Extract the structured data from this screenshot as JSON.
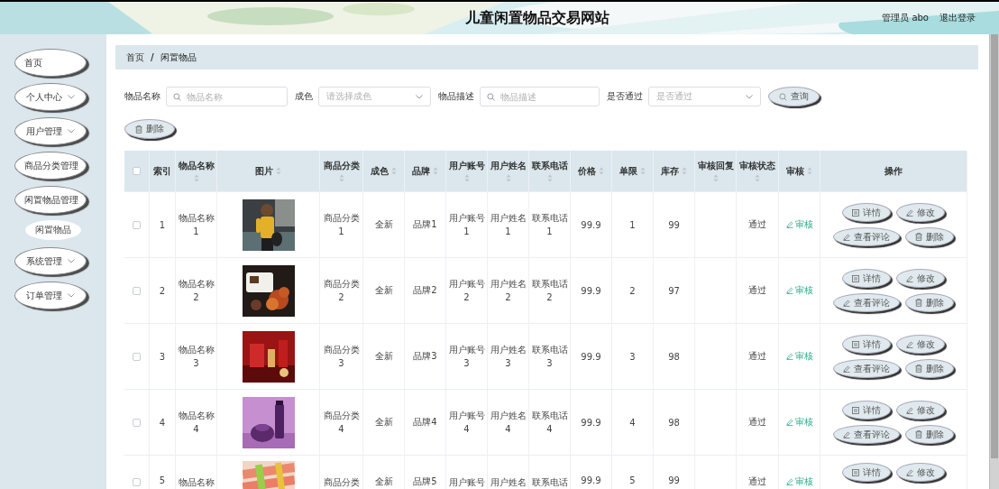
{
  "header": {
    "title": "儿童闲置物品交易网站",
    "user": "管理员 abo",
    "logout": "退出登录"
  },
  "sidebar": {
    "items": [
      {
        "label": "首页",
        "arrow": false
      },
      {
        "label": "个人中心",
        "arrow": true
      },
      {
        "label": "用户管理",
        "arrow": true
      },
      {
        "label": "商品分类管理",
        "arrow": false
      },
      {
        "label": "闲置物品管理",
        "arrow": false,
        "children": [
          {
            "label": "闲置物品"
          }
        ]
      },
      {
        "label": "系统管理",
        "arrow": true
      },
      {
        "label": "订单管理",
        "arrow": true
      }
    ]
  },
  "breadcrumb": {
    "items": [
      "首页",
      "闲置物品"
    ],
    "separator": "/"
  },
  "filters": [
    {
      "label": "物品名称",
      "kind": "input",
      "placeholder": "物品名称"
    },
    {
      "label": "成色",
      "kind": "select",
      "placeholder": "请选择成色"
    },
    {
      "label": "物品描述",
      "kind": "input",
      "placeholder": "物品描述"
    },
    {
      "label": "是否通过",
      "kind": "select",
      "placeholder": "是否通过"
    }
  ],
  "search_button": "查询",
  "delete_button": "删除",
  "table": {
    "select_all": {
      "checked": false
    },
    "columns": [
      {
        "label": "索引",
        "sortable": false
      },
      {
        "label": "物品名称",
        "sortable": true
      },
      {
        "label": "图片",
        "sortable": true
      },
      {
        "label": "商品分类",
        "sortable": true
      },
      {
        "label": "成色",
        "sortable": true
      },
      {
        "label": "品牌",
        "sortable": true
      },
      {
        "label": "用户账号",
        "sortable": true
      },
      {
        "label": "用户姓名",
        "sortable": true
      },
      {
        "label": "联系电话",
        "sortable": true
      },
      {
        "label": "价格",
        "sortable": true
      },
      {
        "label": "单限",
        "sortable": true
      },
      {
        "label": "库存",
        "sortable": true
      },
      {
        "label": "审核回复",
        "sortable": true
      },
      {
        "label": "审核状态",
        "sortable": true
      },
      {
        "label": "审核",
        "sortable": true
      },
      {
        "label": "操作",
        "sortable": false
      }
    ],
    "rows": [
      {
        "checked": false,
        "index": "1",
        "name": "物品名称1",
        "image": {
          "kind": "picture"
        },
        "category": "商品分类1",
        "condition": "全新",
        "brand": "品牌1",
        "account": "用户账号1",
        "user_name": "用户姓名1",
        "phone": "联系电话1",
        "price": "99.9",
        "limit": "1",
        "stock": "99",
        "status": "通过",
        "audit": "审核",
        "actions": [
          {
            "label": "详情",
            "kind": "detail"
          },
          {
            "label": "修改",
            "kind": "edit"
          },
          {
            "label": "查看评论",
            "kind": "comment"
          },
          {
            "label": "删除",
            "kind": "delete"
          }
        ]
      },
      {
        "checked": false,
        "index": "2",
        "name": "物品名称2",
        "image": {
          "kind": "picture"
        },
        "category": "商品分类2",
        "condition": "全新",
        "brand": "品牌2",
        "account": "用户账号2",
        "user_name": "用户姓名2",
        "phone": "联系电话2",
        "price": "99.9",
        "limit": "2",
        "stock": "97",
        "status": "通过",
        "audit": "审核",
        "actions": [
          {
            "label": "详情",
            "kind": "detail"
          },
          {
            "label": "修改",
            "kind": "edit"
          },
          {
            "label": "查看评论",
            "kind": "comment"
          },
          {
            "label": "删除",
            "kind": "delete"
          }
        ]
      },
      {
        "checked": false,
        "index": "3",
        "name": "物品名称3",
        "image": {
          "kind": "picture"
        },
        "category": "商品分类3",
        "condition": "全新",
        "brand": "品牌3",
        "account": "用户账号3",
        "user_name": "用户姓名3",
        "phone": "联系电话3",
        "price": "99.9",
        "limit": "3",
        "stock": "98",
        "status": "通过",
        "audit": "审核",
        "actions": [
          {
            "label": "详情",
            "kind": "detail"
          },
          {
            "label": "修改",
            "kind": "edit"
          },
          {
            "label": "查看评论",
            "kind": "comment"
          },
          {
            "label": "删除",
            "kind": "delete"
          }
        ]
      },
      {
        "checked": false,
        "index": "4",
        "name": "物品名称4",
        "image": {
          "kind": "picture"
        },
        "category": "商品分类4",
        "condition": "全新",
        "brand": "品牌4",
        "account": "用户账号4",
        "user_name": "用户姓名4",
        "phone": "联系电话4",
        "price": "99.9",
        "limit": "4",
        "stock": "98",
        "status": "通过",
        "audit": "审核",
        "actions": [
          {
            "label": "详情",
            "kind": "detail"
          },
          {
            "label": "修改",
            "kind": "edit"
          },
          {
            "label": "查看评论",
            "kind": "comment"
          },
          {
            "label": "删除",
            "kind": "delete"
          }
        ]
      },
      {
        "checked": false,
        "index": "5",
        "name": "物品名称",
        "image": {
          "kind": "picture"
        },
        "category": "商品分类",
        "condition": "全新",
        "brand": "品牌5",
        "account": "用户账号",
        "user_name": "用户姓名",
        "phone": "联系电话",
        "price": "99.9",
        "limit": "5",
        "stock": "99",
        "status": "通过",
        "audit": "审核",
        "actions": [
          {
            "label": "详情",
            "kind": "detail"
          },
          {
            "label": "修改",
            "kind": "edit"
          }
        ]
      }
    ]
  }
}
